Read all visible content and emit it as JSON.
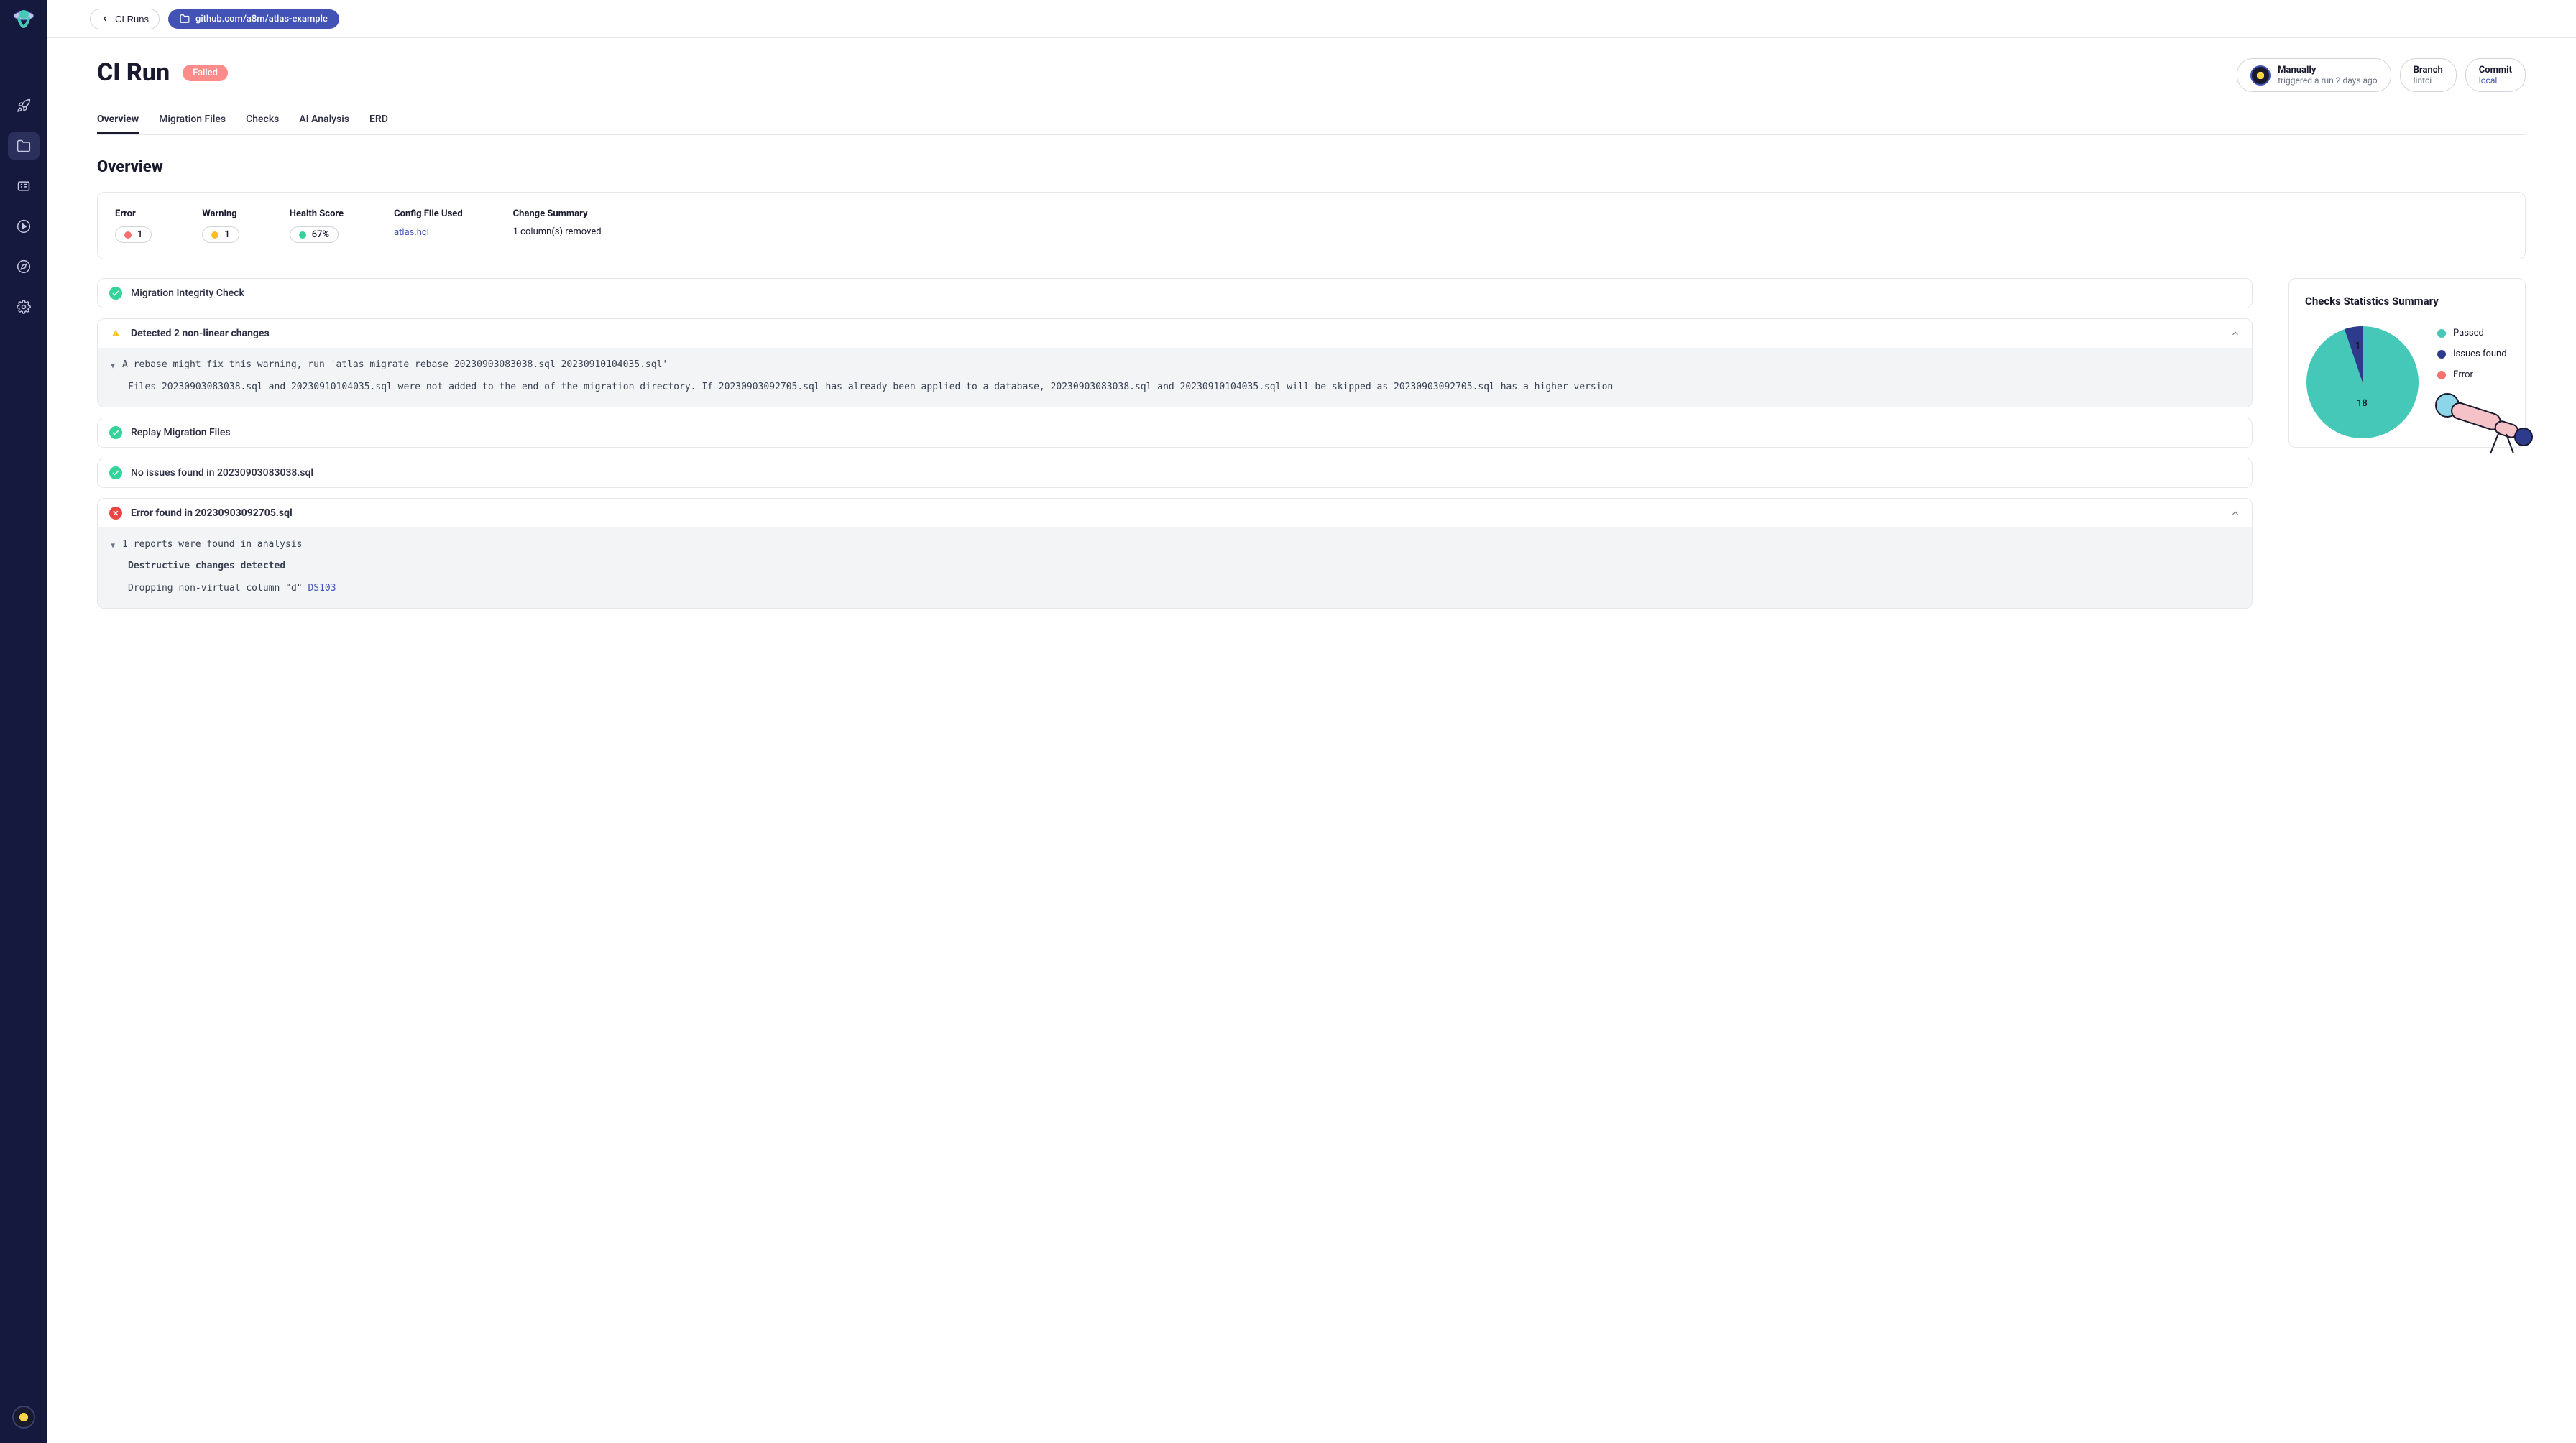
{
  "breadcrumb": {
    "back": "CI Runs",
    "repo": "github.com/a8m/atlas-example"
  },
  "page": {
    "title": "CI Run",
    "status": "Failed"
  },
  "meta": {
    "trigger": {
      "title": "Manually",
      "subtitle": "triggered a run 2 days ago"
    },
    "branch": {
      "title": "Branch",
      "value": "lintci"
    },
    "commit": {
      "title": "Commit",
      "value": "local"
    }
  },
  "tabs": [
    "Overview",
    "Migration Files",
    "Checks",
    "AI Analysis",
    "ERD"
  ],
  "section_title": "Overview",
  "stats": {
    "error": {
      "label": "Error",
      "value": "1"
    },
    "warning": {
      "label": "Warning",
      "value": "1"
    },
    "health": {
      "label": "Health Score",
      "value": "67%"
    },
    "config": {
      "label": "Config File Used",
      "value": "atlas.hcl"
    },
    "change": {
      "label": "Change Summary",
      "value": "1 column(s) removed"
    }
  },
  "checks": {
    "c1": "Migration Integrity Check",
    "c2": {
      "title": "Detected 2 non-linear changes",
      "l1": "A rebase might fix this warning, run 'atlas migrate rebase 20230903083038.sql 20230910104035.sql'",
      "l2": "Files 20230903083038.sql and 20230910104035.sql were not added to the end of the migration directory. If 20230903092705.sql has already been applied to a database, 20230903083038.sql and 20230910104035.sql will be skipped as 20230903092705.sql has a higher version"
    },
    "c3": "Replay Migration Files",
    "c4": "No issues found in 20230903083038.sql",
    "c5": {
      "title": "Error found in 20230903092705.sql",
      "l1": "1 reports were found in analysis",
      "l2": "Destructive changes detected",
      "l3a": "Dropping non-virtual column \"d\" ",
      "l3b": "DS103"
    }
  },
  "summary": {
    "title": "Checks Statistics Summary",
    "legend": {
      "passed": "Passed",
      "issues": "Issues found",
      "error": "Error"
    }
  },
  "chart_data": {
    "type": "pie",
    "title": "Checks Statistics Summary",
    "series": [
      {
        "name": "Passed",
        "value": 18,
        "color": "#46c8b8"
      },
      {
        "name": "Issues found",
        "value": 1,
        "color": "#2e3a8c"
      },
      {
        "name": "Error",
        "value": 0,
        "color": "#f87171"
      }
    ]
  }
}
